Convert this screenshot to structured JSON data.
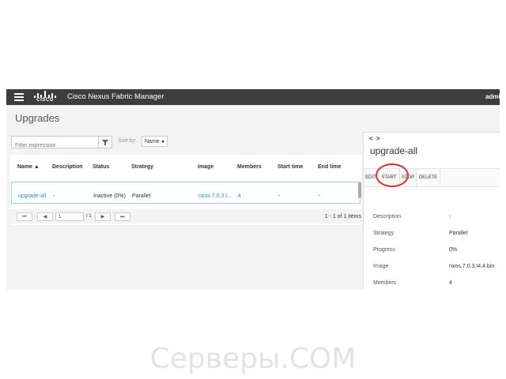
{
  "header": {
    "brand": "CISCO",
    "app_title": "Cisco Nexus Fabric Manager",
    "user": "admi"
  },
  "page_title": "Upgrades",
  "filter": {
    "placeholder": "Filter expression"
  },
  "sort": {
    "label": "Sort by",
    "selected": "Name"
  },
  "table": {
    "columns": [
      "Name ▲",
      "Description",
      "Status",
      "Strategy",
      "Image",
      "Members",
      "Start time",
      "End time"
    ],
    "rows": [
      {
        "name": "upgrade-all",
        "description": "-",
        "status": "Inactive (0%)",
        "strategy": "Parallel",
        "image": "nxos.7.0.3.l...",
        "members": "4",
        "start_time": "-",
        "end_time": "-"
      }
    ]
  },
  "pager": {
    "first": "⏮",
    "prev": "◀",
    "page": "1",
    "total": "/ 1",
    "next": "▶",
    "last": "⏭",
    "info": "1 - 1 of 1 items"
  },
  "detail": {
    "nav": "< >",
    "title": "upgrade-all",
    "actions": {
      "edit": "EDIT",
      "start": "START",
      "stop": "STOP",
      "delete": "DELETE"
    },
    "fields": [
      {
        "label": "Description",
        "value": "-"
      },
      {
        "label": "Strategy",
        "value": "Parallel"
      },
      {
        "label": "Progress",
        "value": "0%"
      },
      {
        "label": "Image",
        "value": "nxos.7.0.3.I4.4.bin"
      },
      {
        "label": "Members",
        "value": "4"
      }
    ]
  },
  "watermark": "Серверы.COM",
  "colors": {
    "topbar": "#3d3d3d",
    "link": "#1a8fd1",
    "highlight_circle": "#e03030"
  }
}
